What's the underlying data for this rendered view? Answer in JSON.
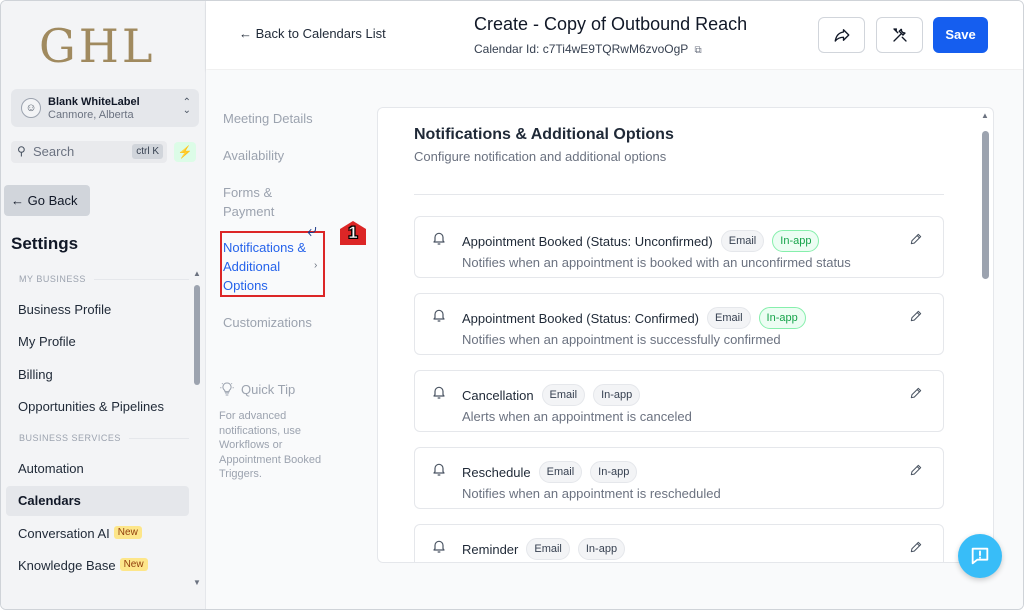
{
  "sidebar": {
    "logo": "GHL",
    "account": {
      "name": "Blank WhiteLabel",
      "location": "Canmore, Alberta"
    },
    "search": {
      "placeholder": "Search",
      "shortcut": "ctrl K"
    },
    "go_back": "Go Back",
    "settings_title": "Settings",
    "sections": [
      {
        "label": "MY BUSINESS",
        "items": [
          "Business Profile",
          "My Profile",
          "Billing",
          "Opportunities & Pipelines"
        ]
      },
      {
        "label": "BUSINESS SERVICES",
        "items": [
          "Automation",
          "Calendars",
          "Conversation AI",
          "Knowledge Base"
        ]
      }
    ],
    "active_item": "Calendars",
    "new_badge": "New"
  },
  "header": {
    "back_label": "Back to Calendars List",
    "title": "Create - Copy of Outbound Reach",
    "calendar_id_label": "Calendar Id:",
    "calendar_id": "c7Ti4wE9TQRwM6zvoOgP",
    "save_label": "Save"
  },
  "steps": {
    "items": [
      "Meeting Details",
      "Availability",
      "Forms & Payment",
      "Notifications & Additional Options",
      "Customizations"
    ],
    "active_index": 3,
    "annotation_number": "1"
  },
  "tip": {
    "title": "Quick Tip",
    "body": "For advanced notifications, use Workflows or Appointment Booked Triggers."
  },
  "card": {
    "title": "Notifications & Additional Options",
    "subtitle": "Configure notification and additional options",
    "notifications": [
      {
        "title": "Appointment Booked (Status: Unconfirmed)",
        "channels": [
          "Email",
          "In-app"
        ],
        "inapp_active": true,
        "description": "Notifies when an appointment is booked with an unconfirmed status"
      },
      {
        "title": "Appointment Booked (Status: Confirmed)",
        "channels": [
          "Email",
          "In-app"
        ],
        "inapp_active": true,
        "description": "Notifies when an appointment is successfully confirmed"
      },
      {
        "title": "Cancellation",
        "channels": [
          "Email",
          "In-app"
        ],
        "inapp_active": false,
        "description": "Alerts when an appointment is canceled"
      },
      {
        "title": "Reschedule",
        "channels": [
          "Email",
          "In-app"
        ],
        "inapp_active": false,
        "description": "Notifies when an appointment is rescheduled"
      },
      {
        "title": "Reminder",
        "channels": [
          "Email",
          "In-app"
        ],
        "inapp_active": false,
        "description": ""
      }
    ]
  },
  "colors": {
    "primary": "#155eef",
    "active_step": "#2563eb",
    "green_pill": "#16a34a",
    "annotation": "#dc2626",
    "help_fab": "#38bdf8"
  },
  "icons": [
    "user-icon",
    "chevron-updown-icon",
    "search-icon",
    "bolt-icon",
    "arrow-left-icon",
    "share-icon",
    "tools-icon",
    "copy-icon",
    "bell-icon",
    "pencil-icon",
    "lightbulb-icon",
    "help-chat-icon"
  ]
}
